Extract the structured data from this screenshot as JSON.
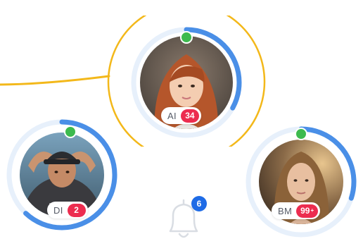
{
  "colors": {
    "accent_blue": "#4a8fe7",
    "ring_track": "#e7f0fb",
    "online_green": "#3dba4e",
    "count_red": "#ec2c4f",
    "highlight_gold": "#f3b81a",
    "bell_badge_blue": "#1e6be6"
  },
  "avatars": [
    {
      "initials": "AI",
      "count": "34",
      "online": true,
      "highlighted": true,
      "progress": 0.33
    },
    {
      "initials": "DI",
      "count": "2",
      "online": true,
      "highlighted": false,
      "progress": 0.62
    },
    {
      "initials": "BM",
      "count": "99",
      "count_suffix": "+",
      "online": true,
      "highlighted": false,
      "progress": 0.3
    }
  ],
  "notifications": {
    "icon": "bell-icon",
    "count": "6"
  }
}
